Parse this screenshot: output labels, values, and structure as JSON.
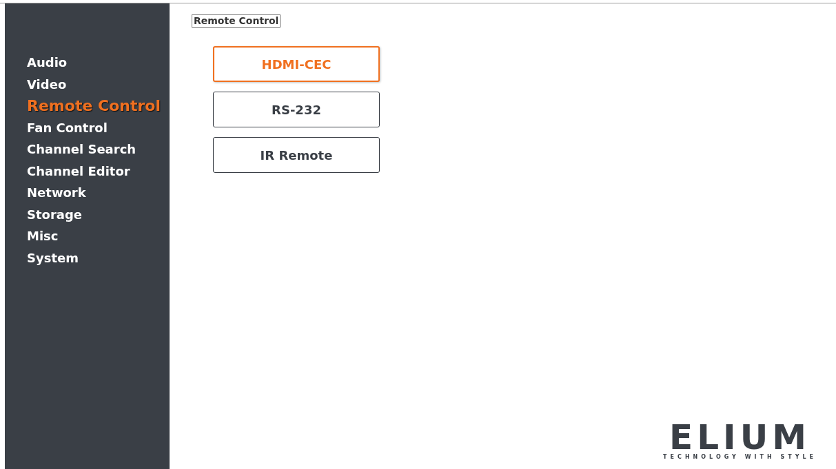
{
  "sidebar": {
    "items": [
      {
        "label": "Audio",
        "selected": false
      },
      {
        "label": "Video",
        "selected": false
      },
      {
        "label": "Remote Control",
        "selected": true
      },
      {
        "label": "Fan Control",
        "selected": false
      },
      {
        "label": "Channel Search",
        "selected": false
      },
      {
        "label": "Channel Editor",
        "selected": false
      },
      {
        "label": "Network",
        "selected": false
      },
      {
        "label": "Storage",
        "selected": false
      },
      {
        "label": "Misc",
        "selected": false
      },
      {
        "label": "System",
        "selected": false
      }
    ]
  },
  "content": {
    "title": "Remote Control",
    "buttons": [
      {
        "label": "HDMI-CEC",
        "selected": true
      },
      {
        "label": "RS-232",
        "selected": false
      },
      {
        "label": "IR Remote",
        "selected": false
      }
    ]
  },
  "logo": {
    "name": "ELIUM",
    "tagline": "TECHNOLOGY WITH STYLE"
  }
}
